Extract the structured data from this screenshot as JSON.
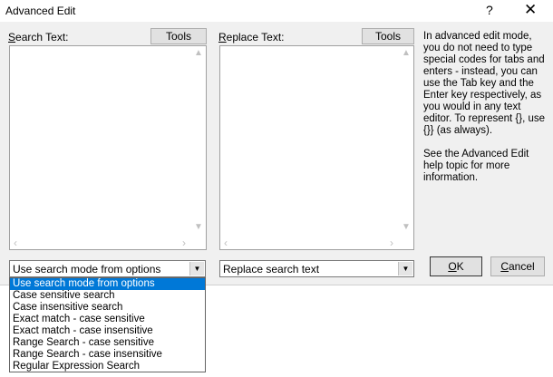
{
  "window": {
    "title": "Advanced Edit",
    "help_glyph": "?",
    "close_glyph": "✕"
  },
  "search": {
    "label_key": "S",
    "label_rest": "earch Text:",
    "tools_label": "Tools",
    "mode_value": "Use search mode from options"
  },
  "replace": {
    "label_key": "R",
    "label_rest": "eplace Text:",
    "tools_label": "Tools",
    "mode_value": "Replace search text"
  },
  "info": {
    "paragraph1": "In advanced edit mode, you do not need to type special codes for tabs and enters - instead, you can use the Tab key and the Enter key respectively, as you would in any text editor. To represent {}, use {}} (as always).",
    "paragraph2": "See the Advanced Edit help topic for more information."
  },
  "buttons": {
    "ok_key": "O",
    "ok_rest": "K",
    "cancel_key": "C",
    "cancel_rest": "ancel"
  },
  "dropdown": {
    "options": [
      "Use search mode from options",
      "Case sensitive search",
      "Case insensitive search",
      "Exact match - case sensitive",
      "Exact match - case insensitive",
      "Range Search - case sensitive",
      "Range Search - case insensitive",
      "Regular Expression Search"
    ],
    "selected_index": 0
  }
}
